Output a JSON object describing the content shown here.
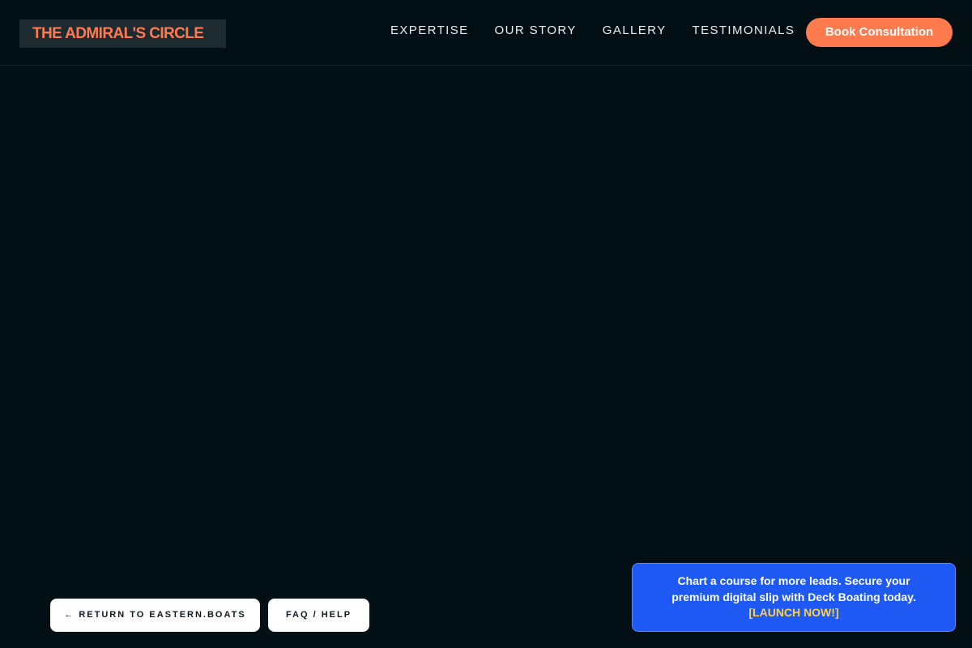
{
  "header": {
    "logo": "THE ADMIRAL'S CIRCLE",
    "nav": [
      {
        "label": "EXPERTISE"
      },
      {
        "label": "OUR STORY"
      },
      {
        "label": "GALLERY"
      },
      {
        "label": "TESTIMONIALS"
      }
    ],
    "cta_label": "Book Consultation"
  },
  "footer_buttons": {
    "return_label": "← RETURN TO EASTERN.BOATS",
    "faq_label": "FAQ / HELP"
  },
  "promo": {
    "text": "Chart a course for more leads. Secure your premium digital slip with Deck Boating today.",
    "link_label": "[LAUNCH NOW!]"
  },
  "colors": {
    "background": "#010f15",
    "accent": "#ff7a4d",
    "promo_blue": "#1f59f4",
    "promo_link": "#ffd24a"
  }
}
